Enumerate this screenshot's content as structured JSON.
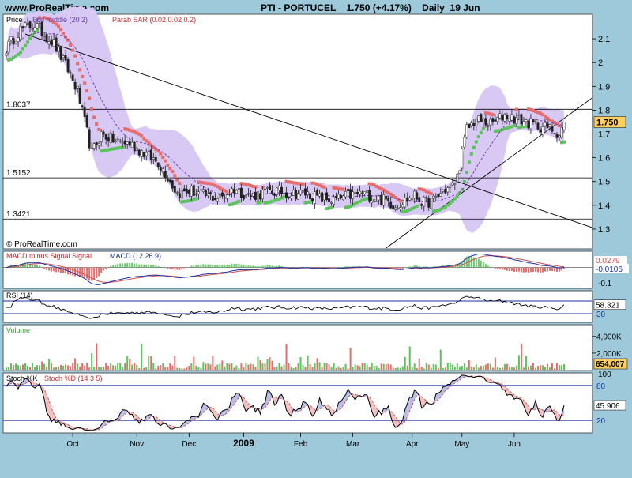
{
  "header": {
    "site": "www.ProRealTime.com",
    "title": "PTI - PORTUCEL    1.750 (+4.17%)    Daily  19 Jun"
  },
  "colors": {
    "background": "#9ec9da",
    "panel": "#ffffff",
    "band": "#d8c8f4",
    "sar_up": "#5cc25c",
    "sar_down": "#e86c6c",
    "candle": "#202020",
    "trend": "#000000",
    "hline": "#000000",
    "macd": "#1c2fa0",
    "signal": "#d05050",
    "hist_up": "#6cc86c",
    "hist_down": "#e86c6c",
    "rsi": "#000000",
    "level": "#1c2fa0",
    "volume_up": "#5cc25c",
    "volume_down": "#e86c6c",
    "stoch_k": "#000000",
    "stoch_d": "#d05050",
    "fill_up": "#b8bce8",
    "fill_down": "#f4c0c0",
    "last_value_box": "#ffd060"
  },
  "chart_data": [
    {
      "id": "price",
      "type": "candlestick",
      "legend": [
        "Price",
        "Boll middle (20 2)",
        "Parab SAR (0.02 0.02 0.2)"
      ],
      "watermark": "© ProRealTime.com",
      "ylim": [
        1.22,
        2.2
      ],
      "yticks": [
        1.3,
        1.4,
        1.5,
        1.6,
        1.7,
        1.8,
        1.9,
        2.0,
        2.1
      ],
      "ytick_labels": [
        "1.3",
        "1.4",
        "1.5",
        "1.6",
        "1.7",
        "1.8",
        "1.9",
        "2",
        "2.1"
      ],
      "hlines": [
        {
          "value": 1.8037,
          "label": "1.8037"
        },
        {
          "value": 1.5152,
          "label": "1.5152"
        },
        {
          "value": 1.3421,
          "label": "1.3421"
        }
      ],
      "last_value": {
        "value": 1.75,
        "label": "1.750"
      },
      "anchors": [
        [
          0,
          2.06
        ],
        [
          6,
          2.14
        ],
        [
          12,
          2.16
        ],
        [
          20,
          2.08
        ],
        [
          26,
          1.97
        ],
        [
          30,
          1.88
        ],
        [
          36,
          1.62
        ],
        [
          40,
          1.7
        ],
        [
          46,
          1.67
        ],
        [
          52,
          1.66
        ],
        [
          58,
          1.62
        ],
        [
          64,
          1.58
        ],
        [
          68,
          1.52
        ],
        [
          72,
          1.45
        ],
        [
          78,
          1.46
        ],
        [
          84,
          1.44
        ],
        [
          90,
          1.43
        ],
        [
          96,
          1.47
        ],
        [
          102,
          1.44
        ],
        [
          108,
          1.45
        ],
        [
          114,
          1.46
        ],
        [
          120,
          1.45
        ],
        [
          126,
          1.45
        ],
        [
          132,
          1.43
        ],
        [
          138,
          1.42
        ],
        [
          144,
          1.44
        ],
        [
          150,
          1.45
        ],
        [
          156,
          1.43
        ],
        [
          160,
          1.42
        ],
        [
          164,
          1.4
        ],
        [
          168,
          1.42
        ],
        [
          172,
          1.44
        ],
        [
          176,
          1.41
        ],
        [
          180,
          1.42
        ],
        [
          184,
          1.46
        ],
        [
          188,
          1.48
        ],
        [
          190,
          1.52
        ],
        [
          194,
          1.72
        ],
        [
          198,
          1.76
        ],
        [
          204,
          1.74
        ],
        [
          210,
          1.78
        ],
        [
          216,
          1.76
        ],
        [
          222,
          1.74
        ],
        [
          226,
          1.73
        ],
        [
          230,
          1.72
        ],
        [
          233,
          1.7
        ],
        [
          235,
          1.75
        ]
      ]
    },
    {
      "id": "macd",
      "type": "line",
      "legend": [
        "MACD minus Signal Signal",
        "MACD (12 26 9)"
      ],
      "ylim": [
        -0.13,
        0.1
      ],
      "yticks": [
        -0.1
      ],
      "ytick_labels": [
        "-0.1"
      ],
      "last_values": [
        {
          "value": 0.0279,
          "label": "0.0279"
        },
        {
          "value": -0.0106,
          "label": "-0.0106"
        }
      ]
    },
    {
      "id": "rsi",
      "type": "line",
      "legend": [
        "RSI (14)"
      ],
      "ylim": [
        5,
        100
      ],
      "levels": [
        {
          "value": 70,
          "label": "70"
        },
        {
          "value": 30,
          "label": "30"
        }
      ],
      "last_value": {
        "value": 58.321,
        "label": "58.321"
      }
    },
    {
      "id": "volume",
      "type": "bar",
      "legend": [
        "Volume"
      ],
      "ylim": [
        0,
        5300000
      ],
      "yticks": [
        2000000,
        4000000
      ],
      "ytick_labels": [
        "2,000K",
        "4,000K"
      ],
      "last_value": {
        "value": 654007,
        "label": "654,007"
      }
    },
    {
      "id": "stoch",
      "type": "line",
      "legend": [
        "Stoch %K",
        "Stoch %D (14 3 5)"
      ],
      "ylim": [
        0,
        100
      ],
      "yticks": [
        100
      ],
      "ytick_labels": [
        "100"
      ],
      "levels": [
        {
          "value": 80,
          "label": "80"
        },
        {
          "value": 20,
          "label": "20"
        }
      ],
      "last_value": {
        "value": 45.906,
        "label": "45.906"
      }
    }
  ],
  "xaxis": {
    "n_bars": 236,
    "labels": [
      {
        "bar": 28,
        "label": "Oct",
        "bold": false
      },
      {
        "bar": 55,
        "label": "Nov",
        "bold": false
      },
      {
        "bar": 77,
        "label": "Dec",
        "bold": false
      },
      {
        "bar": 100,
        "label": "2009",
        "bold": true
      },
      {
        "bar": 124,
        "label": "Feb",
        "bold": false
      },
      {
        "bar": 146,
        "label": "Mar",
        "bold": false
      },
      {
        "bar": 171,
        "label": "Apr",
        "bold": false
      },
      {
        "bar": 192,
        "label": "May",
        "bold": false
      },
      {
        "bar": 214,
        "label": "Jun",
        "bold": false
      }
    ]
  }
}
